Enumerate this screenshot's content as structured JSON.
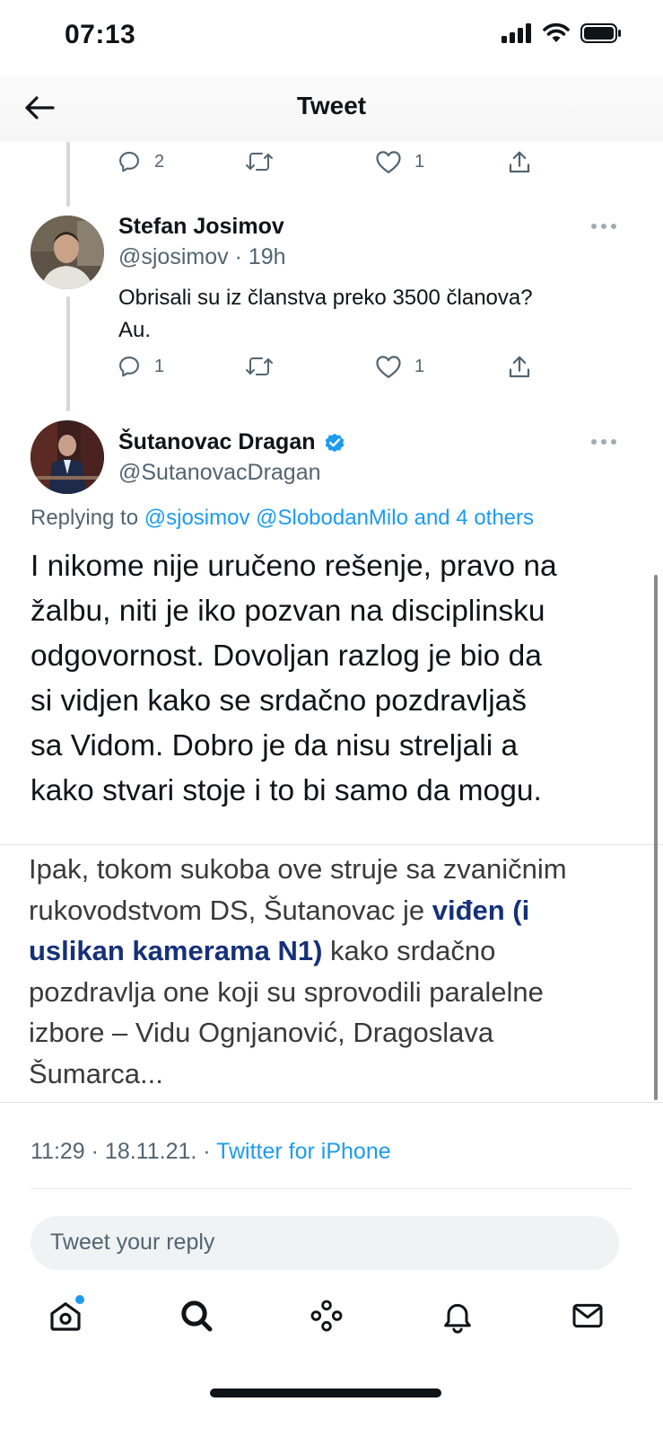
{
  "status_bar": {
    "time": "07:13"
  },
  "header": {
    "title": "Tweet"
  },
  "parent_actions": {
    "replies": "2",
    "retweets": "",
    "likes": "1"
  },
  "reply_tweet": {
    "author_name": "Stefan Josimov",
    "handle": "@sjosimov",
    "time": "19h",
    "text_line1": "Obrisali su iz članstva preko 3500 članova?",
    "text_line2": "Au.",
    "replies": "1",
    "likes": "1"
  },
  "main_tweet": {
    "author_name": "Šutanovac Dragan",
    "handle": "@SutanovacDragan",
    "replying_prefix": "Replying to",
    "replying_links": "@sjosimov @SlobodanMilo and 4 others",
    "lines": [
      "I nikome nije uručeno rešenje, pravo na",
      "žalbu, niti je iko pozvan na disciplinsku",
      "odgovornost. Dovoljan razlog je bio da",
      "si vidjen kako se srdačno pozdravljaš",
      "sa Vidom. Dobro je da nisu streljali a",
      "kako stvari stoje i to bi samo da mogu."
    ],
    "timestamp": "11:29 · 18.11.21. ·",
    "source": "Twitter for iPhone"
  },
  "quote_image": {
    "line1": "Ipak, tokom sukoba ove struje sa zvaničnim",
    "line2_a": "rukovodstvom DS, Šutanovac je ",
    "line2_b": "viđen (i",
    "line3_a": "uslikan kamerama N1)",
    "line3_b": " kako srdačno",
    "line4": "pozdravlja one koji su sprovodili paralelne",
    "line5": "izbore – Vidu Ognjanović, Dragoslava",
    "line6": "Šumarca..."
  },
  "reply_input": {
    "placeholder": "Tweet your reply"
  },
  "colors": {
    "accent": "#1d9bf0",
    "text": "#0f1419",
    "secondary": "#536471",
    "verified": "#1d9bf0",
    "highlight": "#16307a"
  },
  "icons": [
    "back-arrow-icon",
    "reply-icon",
    "retweet-icon",
    "like-icon",
    "share-icon",
    "more-icon",
    "verified-icon",
    "home-icon",
    "search-icon",
    "spaces-icon",
    "notifications-icon",
    "messages-icon"
  ]
}
